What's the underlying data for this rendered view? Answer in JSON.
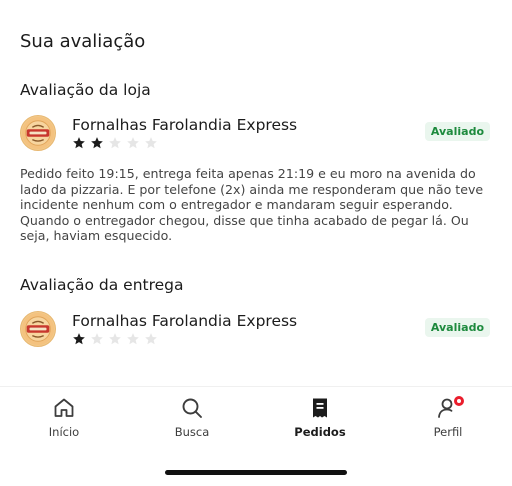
{
  "page_title": "Sua avaliação",
  "store_review": {
    "section_title": "Avaliação da loja",
    "store_name": "Fornalhas Farolandia Express",
    "rating": 2,
    "max_rating": 5,
    "status": "Avaliado",
    "comment": "Pedido feito 19:15, entrega feita apenas 21:19 e eu moro na avenida do lado da pizzaria. E por telefone (2x) ainda me responderam que não teve incidente nenhum com o entregador e mandaram seguir esperando. Quando o entregador chegou, disse que tinha acabado de pegar lá. Ou seja, haviam esquecido."
  },
  "delivery_review": {
    "section_title": "Avaliação da entrega",
    "store_name": "Fornalhas Farolandia Express",
    "rating": 1,
    "max_rating": 5,
    "status": "Avaliado"
  },
  "tabbar": {
    "items": [
      {
        "label": "Início",
        "icon": "home-icon"
      },
      {
        "label": "Busca",
        "icon": "search-icon"
      },
      {
        "label": "Pedidos",
        "icon": "receipt-icon",
        "active": true
      },
      {
        "label": "Perfil",
        "icon": "profile-icon",
        "notification": true
      }
    ]
  },
  "colors": {
    "star_filled": "#1c1c1c",
    "star_empty": "#e6e6e6",
    "badge_text": "#1d8a3d",
    "badge_bg": "#eaf6ee",
    "notification": "#ea1d2c"
  }
}
